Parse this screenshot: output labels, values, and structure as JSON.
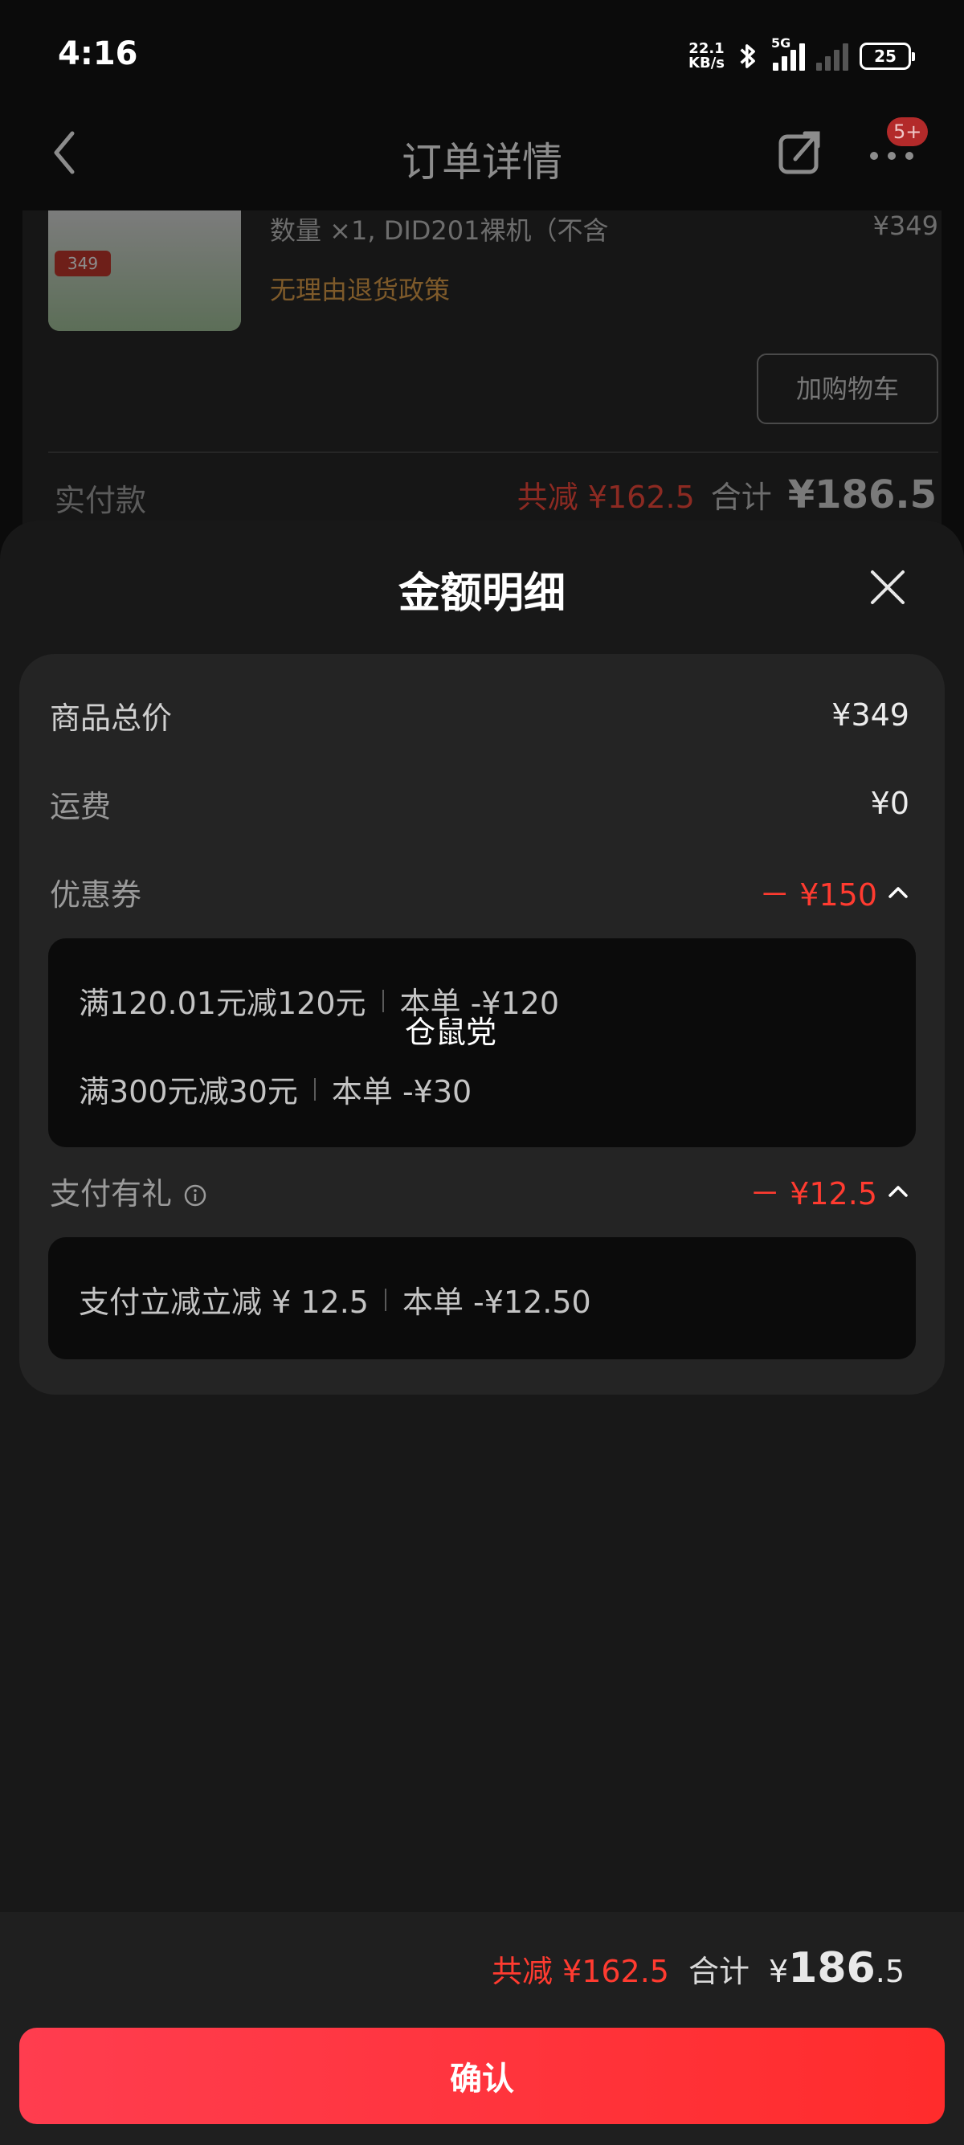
{
  "status_bar": {
    "time": "4:16",
    "net_speed_value": "22.1",
    "net_speed_unit": "KB/s",
    "network": "5G",
    "battery": "25"
  },
  "header": {
    "title": "订单详情",
    "badge": "5+"
  },
  "order_background": {
    "spec": "数量 ×1, DID201裸机（不含",
    "price": "¥349",
    "return_policy": "无理由退货政策",
    "add_cart": "加购物车",
    "paid_label": "实付款",
    "saved": "共减 ¥162.5",
    "total_label": "合计",
    "total": "¥186.5",
    "product_price_tag": "349"
  },
  "sheet": {
    "title": "金额明细",
    "goods_total_label": "商品总价",
    "goods_total_value": "¥349",
    "shipping_label": "运费",
    "shipping_value": "¥0",
    "coupon_label": "优惠券",
    "coupon_value": "－ ¥150",
    "coupons": [
      {
        "rule": "满120.01元减120元",
        "detail": "本单 -¥120"
      },
      {
        "rule": "满300元减30元",
        "detail": "本单 -¥30"
      }
    ],
    "pay_gift_label": "支付有礼",
    "pay_gift_value": "－ ¥12.5",
    "pay_gifts": [
      {
        "rule": "支付立减立减 ¥ 12.5",
        "detail": "本单 -¥12.50"
      }
    ],
    "watermark": "仓鼠党"
  },
  "footer": {
    "saved": "共减 ¥162.5",
    "total_label": "合计",
    "total_currency": "¥",
    "total_int": "186",
    "total_dec": ".5",
    "confirm": "确认"
  },
  "colors": {
    "accent_red": "#ff3b30",
    "button_gradient_start": "#ff3d4f",
    "button_gradient_end": "#ff2c2c"
  }
}
